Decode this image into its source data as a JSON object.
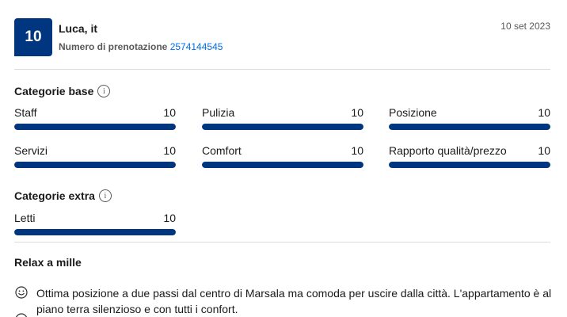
{
  "review": {
    "score": "10",
    "reviewer": "Luca, it",
    "booking_label": "Numero di prenotazione",
    "booking_number": "2574144545",
    "date": "10 set 2023"
  },
  "base_section": {
    "title": "Categorie base",
    "info_icon": "info-icon",
    "categories": [
      {
        "label": "Staff",
        "score": "10",
        "fill": 1.0
      },
      {
        "label": "Pulizia",
        "score": "10",
        "fill": 1.0
      },
      {
        "label": "Posizione",
        "score": "10",
        "fill": 1.0
      },
      {
        "label": "Servizi",
        "score": "10",
        "fill": 1.0
      },
      {
        "label": "Comfort",
        "score": "10",
        "fill": 1.0
      },
      {
        "label": "Rapporto qualità/prezzo",
        "score": "10",
        "fill": 1.0
      }
    ]
  },
  "extra_section": {
    "title": "Categorie extra",
    "info_icon": "info-icon",
    "categories": [
      {
        "label": "Letti",
        "score": "10",
        "fill": 1.0
      }
    ]
  },
  "review_body": {
    "title": "Relax a mille",
    "positive_icon": "smile-icon",
    "positive_text": "Ottima posizione a due passi dal centro di Marsala ma comoda per uscire dalla città. L'appartamento è al piano terra silenzioso e con tutti i confort."
  },
  "colors": {
    "brand": "#003580",
    "link": "#006ce4",
    "track": "#e7e7e7"
  }
}
